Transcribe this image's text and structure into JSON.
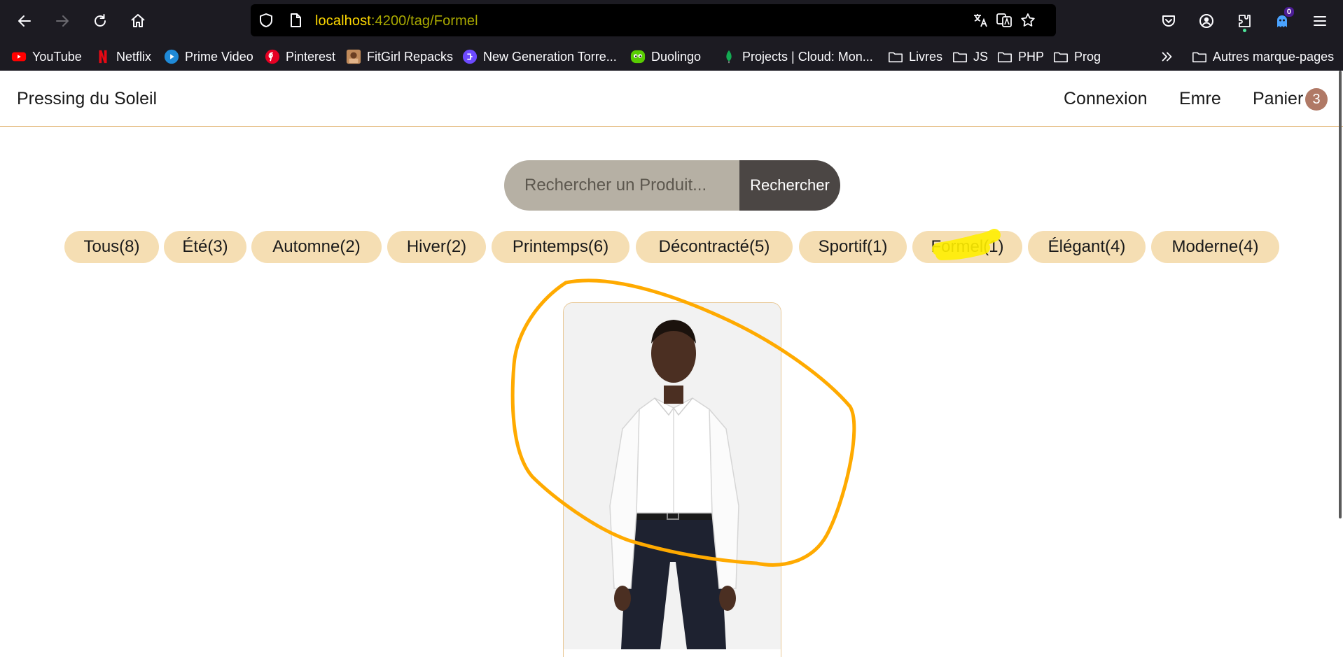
{
  "browser": {
    "url_host": "localhost",
    "url_path": ":4200/tag/Formel",
    "extension_badge": "0",
    "bookmarks": [
      {
        "label": "YouTube",
        "icon": "youtube-icon"
      },
      {
        "label": "Netflix",
        "icon": "netflix-icon"
      },
      {
        "label": "Prime Video",
        "icon": "prime-video-icon"
      },
      {
        "label": "Pinterest",
        "icon": "pinterest-icon"
      },
      {
        "label": "FitGirl Repacks",
        "icon": "fitgirl-icon"
      },
      {
        "label": "New Generation Torre...",
        "icon": "torrent-icon"
      },
      {
        "label": "Duolingo",
        "icon": "duolingo-icon"
      },
      {
        "label": "Projects | Cloud: Mon...",
        "icon": "mongodb-icon"
      },
      {
        "label": "Livres",
        "icon": "folder-icon"
      },
      {
        "label": "JS",
        "icon": "folder-icon"
      },
      {
        "label": "PHP",
        "icon": "folder-icon"
      },
      {
        "label": "Prog",
        "icon": "folder-icon"
      }
    ],
    "other_bookmarks": "Autres marque-pages"
  },
  "header": {
    "brand": "Pressing du Soleil",
    "login": "Connexion",
    "user": "Emre",
    "cart": "Panier",
    "cart_count": "3"
  },
  "search": {
    "placeholder": "Rechercher un Produit...",
    "button": "Rechercher"
  },
  "tags": [
    {
      "label": "Tous(8)"
    },
    {
      "label": "Été(3)"
    },
    {
      "label": "Automne(2)"
    },
    {
      "label": "Hiver(2)"
    },
    {
      "label": "Printemps(6)"
    },
    {
      "label": "Décontracté(5)"
    },
    {
      "label": "Sportif(1)"
    },
    {
      "label": "Formel(1)"
    },
    {
      "label": "Élégant(4)"
    },
    {
      "label": "Moderne(4)"
    }
  ],
  "colors": {
    "tag_bg": "#f5deb3",
    "accent": "#e0b06a",
    "annotation_circle": "#ffaa00",
    "annotation_highlight": "#ffee00",
    "cart_badge": "#b07966"
  },
  "product": {
    "image": "man in white dress shirt and navy trousers"
  }
}
